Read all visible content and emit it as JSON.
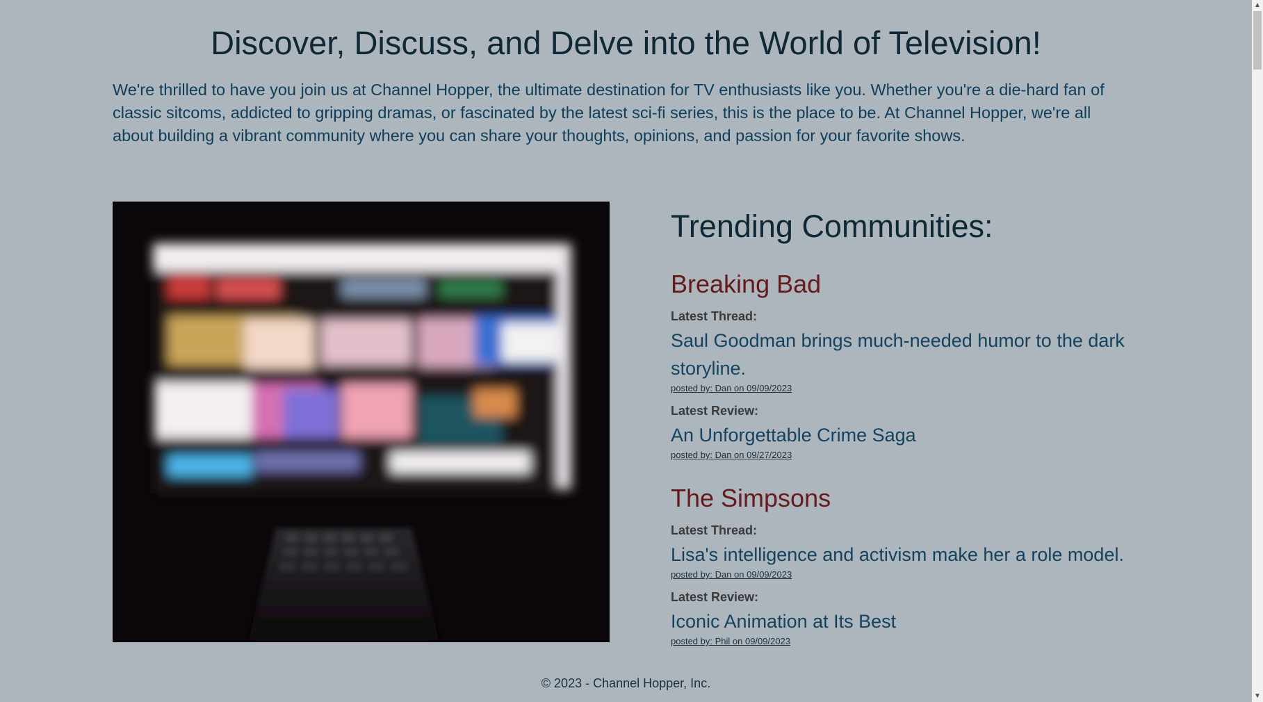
{
  "hero": {
    "title": "Discover, Discuss, and Delve into the World of Television!",
    "intro": "We're thrilled to have you join us at Channel Hopper, the ultimate destination for TV enthusiasts like you. Whether you're a die-hard fan of classic sitcoms, addicted to gripping dramas, or fascinated by the latest sci-fi series, this is the place to be. At Channel Hopper, we're all about building a vibrant community where you can share your thoughts, opinions, and passion for your favorite shows."
  },
  "trending": {
    "title": "Trending Communities:",
    "communities": [
      {
        "name": "Breaking Bad",
        "thread_label": "Latest Thread:",
        "thread_title": "Saul Goodman brings much-needed humor to the dark storyline.",
        "thread_posted": "posted by: Dan on 09/09/2023",
        "review_label": "Latest Review:",
        "review_title": "An Unforgettable Crime Saga",
        "review_posted": "posted by: Dan on 09/27/2023"
      },
      {
        "name": "The Simpsons",
        "thread_label": "Latest Thread:",
        "thread_title": "Lisa's intelligence and activism make her a role model.",
        "thread_posted": "posted by: Dan on 09/09/2023",
        "review_label": "Latest Review:",
        "review_title": "Iconic Animation at Its Best",
        "review_posted": "posted by: Phil on 09/09/2023"
      }
    ]
  },
  "footer": {
    "text": "© 2023 - Channel Hopper, Inc."
  },
  "scrollbar": {
    "up_icon": "chevron-up-icon",
    "down_icon": "chevron-down-icon"
  },
  "colors": {
    "background": "#adb5bd",
    "heading": "#0e2836",
    "community_name": "#651a1d",
    "link": "#15435f"
  }
}
